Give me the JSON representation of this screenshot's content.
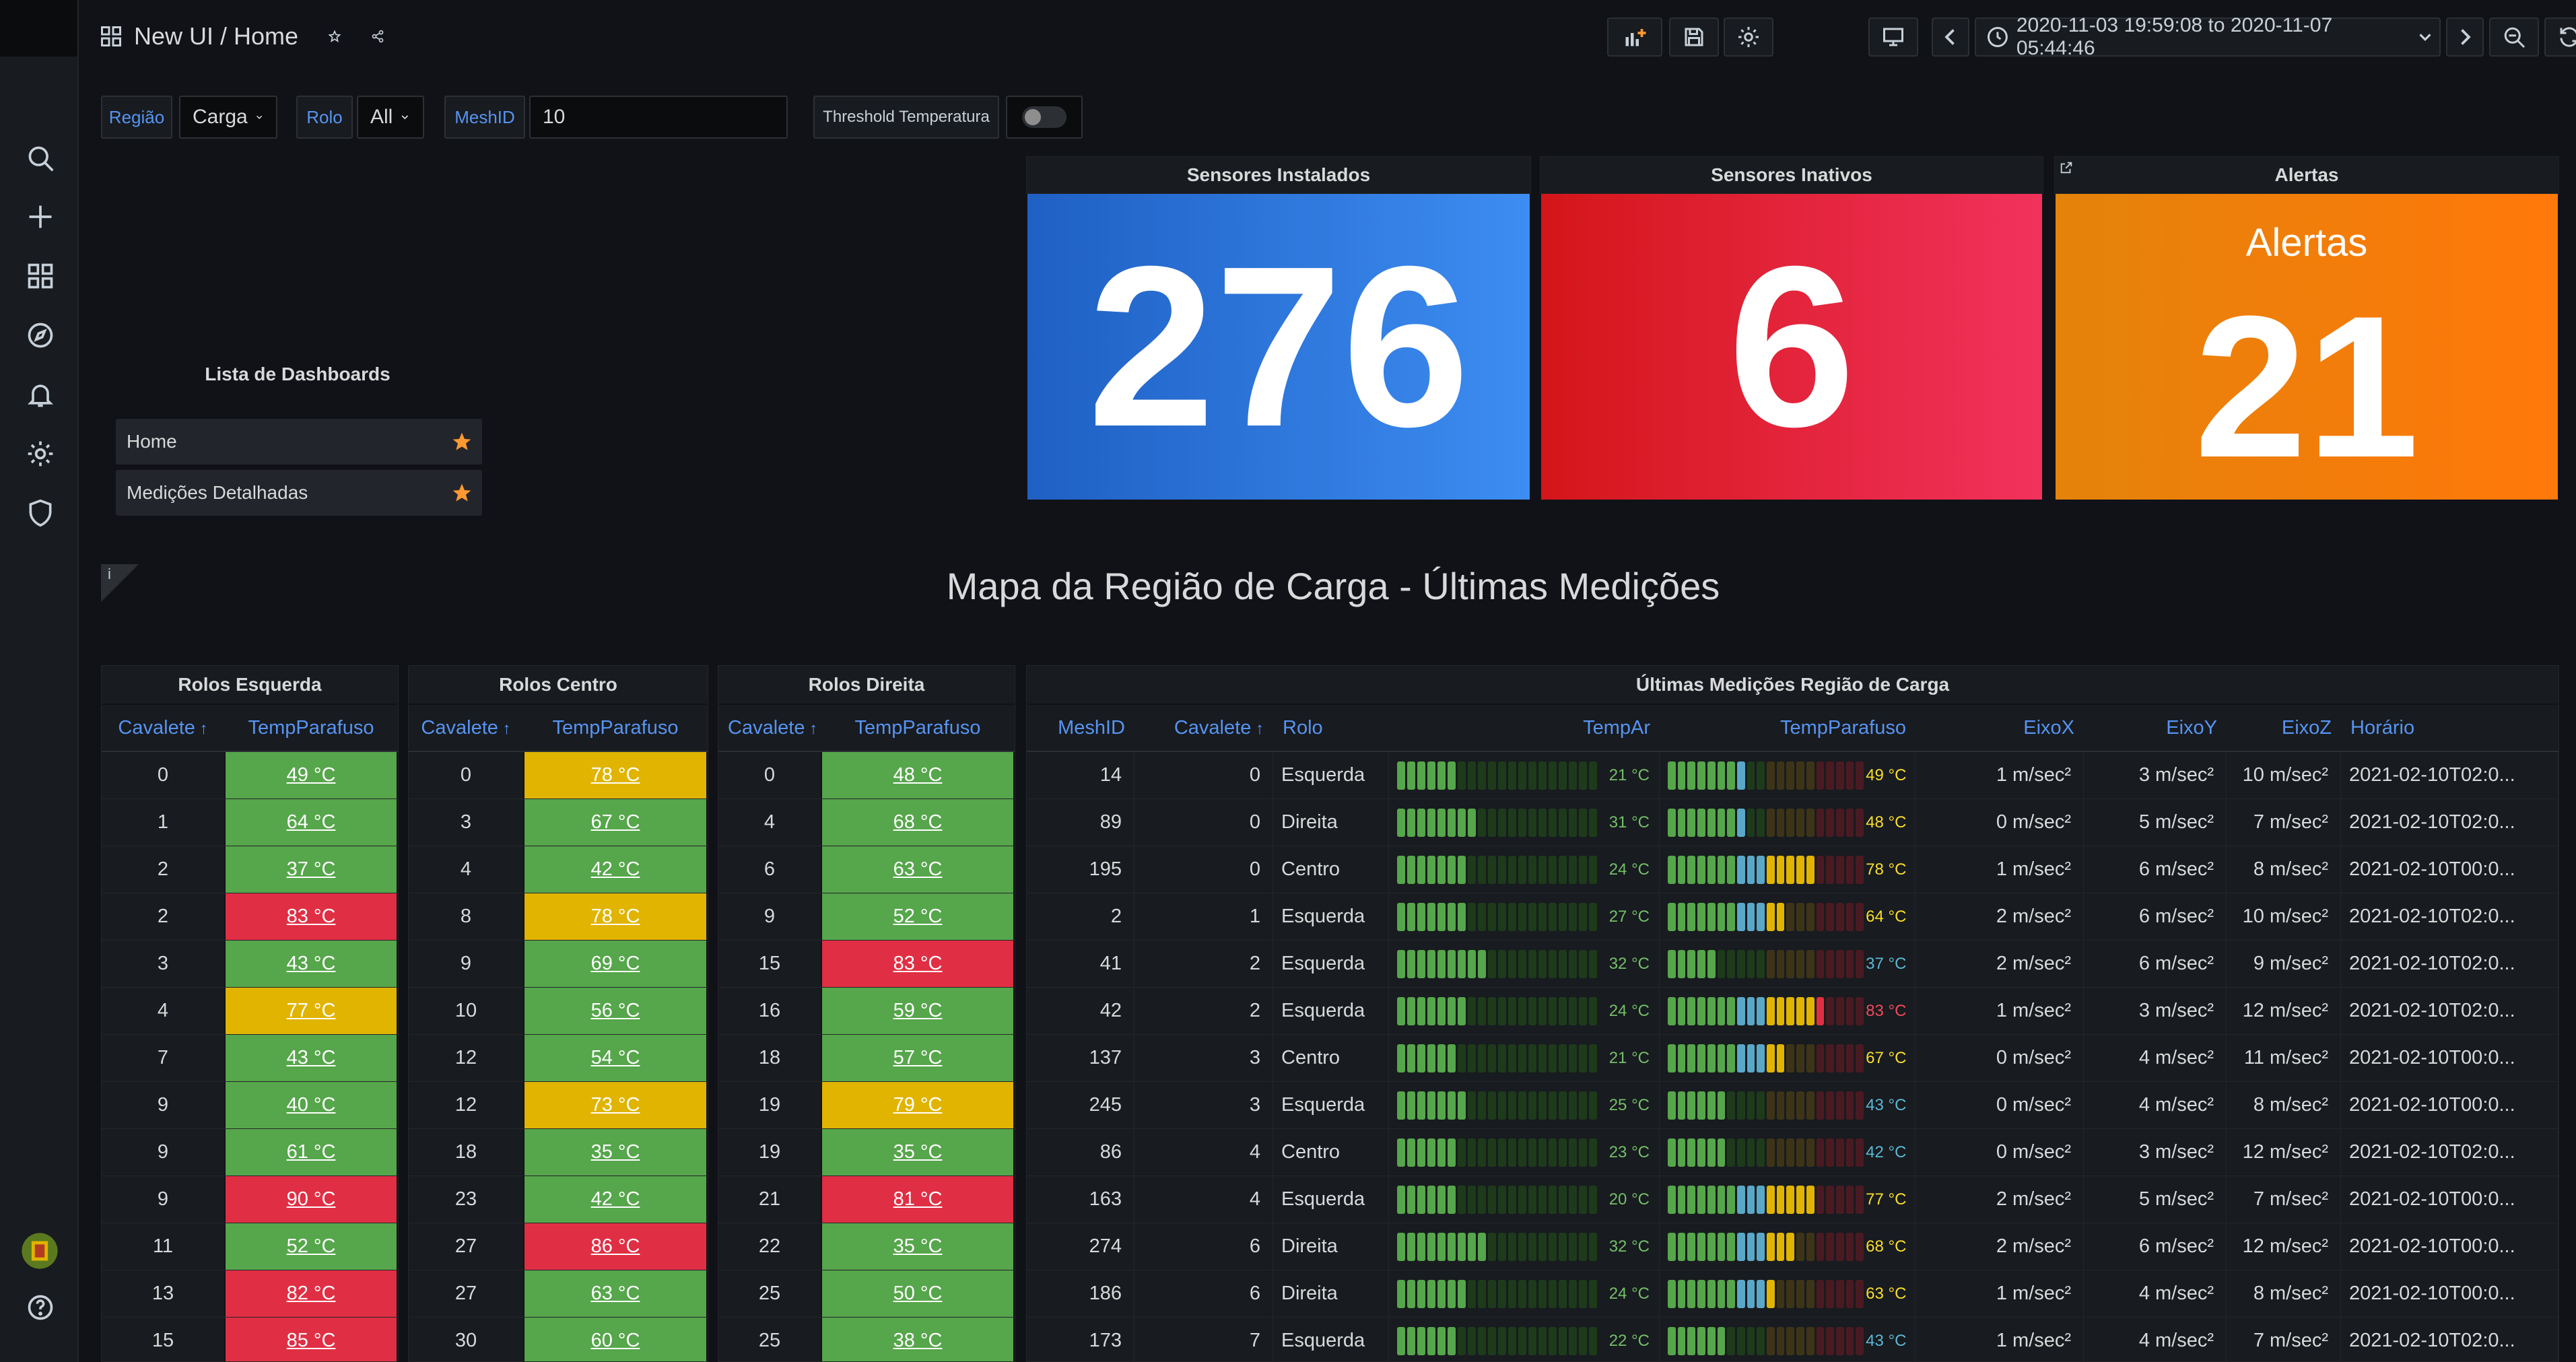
{
  "sidebar": {
    "items": [
      "search",
      "create",
      "dashboards",
      "explore",
      "alerting",
      "configuration",
      "server-admin"
    ],
    "bottom": [
      "avatar",
      "help"
    ]
  },
  "header": {
    "breadcrumb": "New UI / Home",
    "time_range": "2020-11-03 19:59:08 to 2020-11-07 05:44:46"
  },
  "variables": {
    "regiao_label": "Região",
    "regiao_value": "Carga",
    "rolo_label": "Rolo",
    "rolo_value": "All",
    "meshid_label": "MeshID",
    "meshid_value": "10",
    "threshold_label": "Threshold Temperatura",
    "threshold_on": false
  },
  "stats": {
    "installed": {
      "title": "Sensores Instalados",
      "value": "276",
      "color": "#3274d9"
    },
    "inactive": {
      "title": "Sensores Inativos",
      "value": "6",
      "color": "#e02f44"
    },
    "alerts": {
      "title": "Alertas",
      "label": "Alertas",
      "value": "21",
      "color": "#ff780a"
    }
  },
  "dashlist": {
    "title": "Lista de Dashboards",
    "items": [
      "Home",
      "Medições Detalhadas"
    ]
  },
  "map_title": "Mapa da Região de Carga - Últimas Medições",
  "info_icon": "i",
  "tables": {
    "left": {
      "title": "Rolos Esquerda",
      "headers": [
        "Cavalete",
        "TempParafuso"
      ],
      "rows": [
        [
          "0",
          "49 °C",
          "green"
        ],
        [
          "1",
          "64 °C",
          "green"
        ],
        [
          "2",
          "37 °C",
          "green"
        ],
        [
          "2",
          "83 °C",
          "red"
        ],
        [
          "3",
          "43 °C",
          "green"
        ],
        [
          "4",
          "77 °C",
          "yellow"
        ],
        [
          "7",
          "43 °C",
          "green"
        ],
        [
          "9",
          "40 °C",
          "green"
        ],
        [
          "9",
          "61 °C",
          "green"
        ],
        [
          "9",
          "90 °C",
          "red"
        ],
        [
          "11",
          "52 °C",
          "green"
        ],
        [
          "13",
          "82 °C",
          "red"
        ],
        [
          "15",
          "85 °C",
          "red"
        ]
      ]
    },
    "center": {
      "title": "Rolos Centro",
      "headers": [
        "Cavalete",
        "TempParafuso"
      ],
      "rows": [
        [
          "0",
          "78 °C",
          "yellow"
        ],
        [
          "3",
          "67 °C",
          "green"
        ],
        [
          "4",
          "42 °C",
          "green"
        ],
        [
          "8",
          "78 °C",
          "yellow"
        ],
        [
          "9",
          "69 °C",
          "green"
        ],
        [
          "10",
          "56 °C",
          "green"
        ],
        [
          "12",
          "54 °C",
          "green"
        ],
        [
          "12",
          "73 °C",
          "yellow"
        ],
        [
          "18",
          "35 °C",
          "green"
        ],
        [
          "23",
          "42 °C",
          "green"
        ],
        [
          "27",
          "86 °C",
          "red"
        ],
        [
          "27",
          "63 °C",
          "green"
        ],
        [
          "30",
          "60 °C",
          "green"
        ]
      ]
    },
    "right": {
      "title": "Rolos Direita",
      "headers": [
        "Cavalete",
        "TempParafuso"
      ],
      "rows": [
        [
          "0",
          "48 °C",
          "green"
        ],
        [
          "4",
          "68 °C",
          "green"
        ],
        [
          "6",
          "63 °C",
          "green"
        ],
        [
          "9",
          "52 °C",
          "green"
        ],
        [
          "15",
          "83 °C",
          "red"
        ],
        [
          "16",
          "59 °C",
          "green"
        ],
        [
          "18",
          "57 °C",
          "green"
        ],
        [
          "19",
          "79 °C",
          "yellow"
        ],
        [
          "19",
          "35 °C",
          "green"
        ],
        [
          "21",
          "81 °C",
          "red"
        ],
        [
          "22",
          "35 °C",
          "green"
        ],
        [
          "25",
          "50 °C",
          "green"
        ],
        [
          "25",
          "38 °C",
          "green"
        ]
      ]
    },
    "latest": {
      "title": "Últimas Medições Região de Carga",
      "headers": [
        "MeshID",
        "Cavalete",
        "Rolo",
        "TempAr",
        "TempParafuso",
        "EixoX",
        "EixoY",
        "EixoZ",
        "Horário"
      ],
      "rows": [
        [
          "14",
          "0",
          "Esquerda",
          "21 °C",
          "49 °C",
          "1 m/sec²",
          "3 m/sec²",
          "10 m/sec²",
          "2021-02-10T02:0..."
        ],
        [
          "89",
          "0",
          "Direita",
          "31 °C",
          "48 °C",
          "0 m/sec²",
          "5 m/sec²",
          "7 m/sec²",
          "2021-02-10T02:0..."
        ],
        [
          "195",
          "0",
          "Centro",
          "24 °C",
          "78 °C",
          "1 m/sec²",
          "6 m/sec²",
          "8 m/sec²",
          "2021-02-10T00:0..."
        ],
        [
          "2",
          "1",
          "Esquerda",
          "27 °C",
          "64 °C",
          "2 m/sec²",
          "6 m/sec²",
          "10 m/sec²",
          "2021-02-10T02:0..."
        ],
        [
          "41",
          "2",
          "Esquerda",
          "32 °C",
          "37 °C",
          "2 m/sec²",
          "6 m/sec²",
          "9 m/sec²",
          "2021-02-10T02:0..."
        ],
        [
          "42",
          "2",
          "Esquerda",
          "24 °C",
          "83 °C",
          "1 m/sec²",
          "3 m/sec²",
          "12 m/sec²",
          "2021-02-10T02:0..."
        ],
        [
          "137",
          "3",
          "Centro",
          "21 °C",
          "67 °C",
          "0 m/sec²",
          "4 m/sec²",
          "11 m/sec²",
          "2021-02-10T00:0..."
        ],
        [
          "245",
          "3",
          "Esquerda",
          "25 °C",
          "43 °C",
          "0 m/sec²",
          "4 m/sec²",
          "8 m/sec²",
          "2021-02-10T00:0..."
        ],
        [
          "86",
          "4",
          "Centro",
          "23 °C",
          "42 °C",
          "0 m/sec²",
          "3 m/sec²",
          "12 m/sec²",
          "2021-02-10T02:0..."
        ],
        [
          "163",
          "4",
          "Esquerda",
          "20 °C",
          "77 °C",
          "2 m/sec²",
          "5 m/sec²",
          "7 m/sec²",
          "2021-02-10T00:0..."
        ],
        [
          "274",
          "6",
          "Direita",
          "32 °C",
          "68 °C",
          "2 m/sec²",
          "6 m/sec²",
          "12 m/sec²",
          "2021-02-10T00:0..."
        ],
        [
          "186",
          "6",
          "Direita",
          "24 °C",
          "63 °C",
          "1 m/sec²",
          "4 m/sec²",
          "8 m/sec²",
          "2021-02-10T00:0..."
        ],
        [
          "173",
          "7",
          "Esquerda",
          "22 °C",
          "43 °C",
          "1 m/sec²",
          "4 m/sec²",
          "7 m/sec²",
          "2021-02-10T02:0..."
        ]
      ]
    }
  },
  "colors": {
    "green": "#56a64b",
    "yellow": "#e0b400",
    "red": "#e02f44",
    "link_blue": "#5794f2",
    "background": "#111217",
    "panel": "#181b1f"
  }
}
